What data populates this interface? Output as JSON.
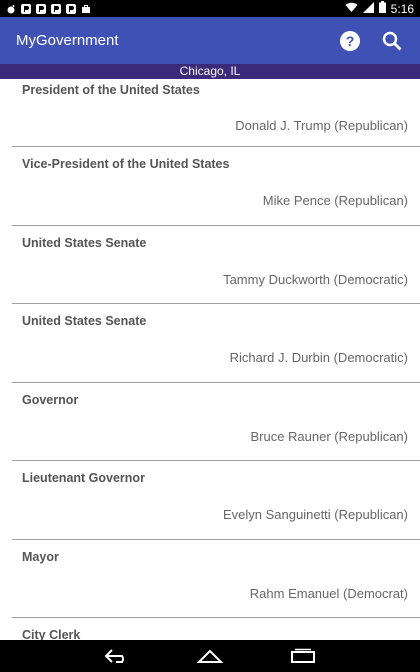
{
  "status_bar": {
    "time": "5:16",
    "notification_icons": [
      "reddit-icon",
      "pandora-icon",
      "pandora-icon",
      "pandora-icon",
      "pandora-icon",
      "briefcase-icon"
    ],
    "right_icons": [
      "wifi-icon",
      "signal-icon",
      "battery-icon"
    ]
  },
  "app_bar": {
    "title": "MyGovernment",
    "actions": [
      "help-icon",
      "search-icon"
    ],
    "color": "#3f51b5"
  },
  "location": {
    "text": "Chicago, IL",
    "color": "#3b2a7a"
  },
  "officials": [
    {
      "office": "President of the United States",
      "official": "Donald J. Trump (Republican)"
    },
    {
      "office": "Vice-President of the United States",
      "official": "Mike Pence (Republican)"
    },
    {
      "office": "United States Senate",
      "official": "Tammy Duckworth (Democratic)"
    },
    {
      "office": "United States Senate",
      "official": "Richard J. Durbin (Democratic)"
    },
    {
      "office": "Governor",
      "official": "Bruce Rauner (Republican)"
    },
    {
      "office": "Lieutenant Governor",
      "official": "Evelyn Sanguinetti (Republican)"
    },
    {
      "office": "Mayor",
      "official": "Rahm Emanuel (Democrat)"
    },
    {
      "office": "City Clerk",
      "official": ""
    }
  ],
  "nav_bar": {
    "buttons": [
      "back-icon",
      "home-icon",
      "recents-icon"
    ]
  }
}
